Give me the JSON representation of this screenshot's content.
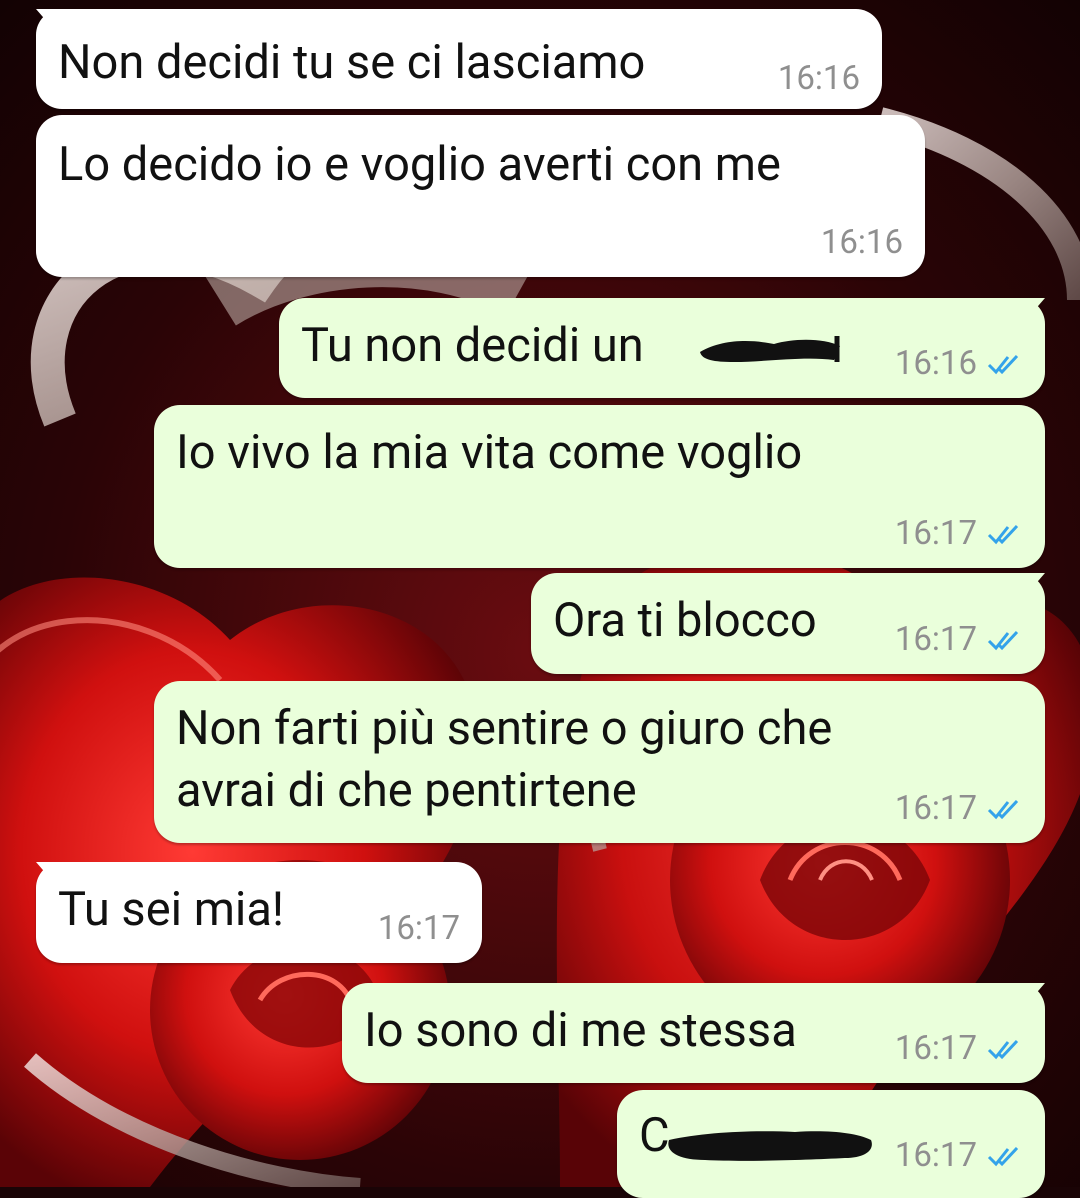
{
  "messages": [
    {
      "direction": "in",
      "text": "Non decidi tu se ci lasciamo",
      "time": "16:16"
    },
    {
      "direction": "in",
      "text": "Lo decido io e voglio averti con me",
      "time": "16:16"
    },
    {
      "direction": "out",
      "text": "Tu non decidi un ",
      "redacted": true,
      "time": "16:16",
      "status": "read"
    },
    {
      "direction": "out",
      "text": "Io vivo la mia vita come voglio",
      "time": "16:17",
      "status": "read"
    },
    {
      "direction": "out",
      "text": "Ora ti blocco",
      "time": "16:17",
      "status": "read"
    },
    {
      "direction": "out",
      "text": "Non farti più sentire o giuro che",
      "text2": "avrai di che pentirtene",
      "time": "16:17",
      "status": "read"
    },
    {
      "direction": "in",
      "text": "Tu sei mia!",
      "time": "16:17"
    },
    {
      "direction": "out",
      "text": "Io sono di me stessa",
      "time": "16:17",
      "status": "read"
    },
    {
      "direction": "out",
      "text": "C",
      "redacted": true,
      "time": "16:17",
      "status": "read"
    }
  ],
  "colors": {
    "incoming_bubble": "#ffffff",
    "outgoing_bubble": "#eaffdb",
    "read_tick": "#34a3ea",
    "timestamp": "#8f8f8f"
  },
  "icons": {
    "read_receipt": "double-check-icon",
    "redaction": "scribble-redaction"
  }
}
